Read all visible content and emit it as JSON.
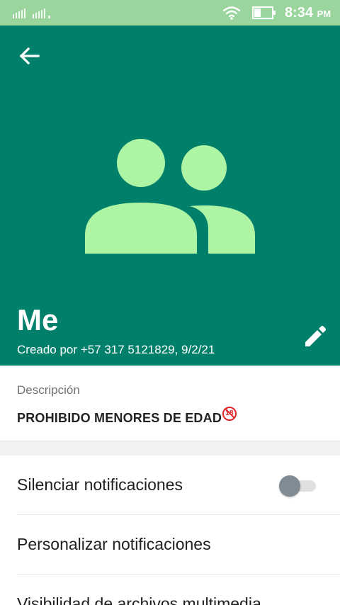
{
  "status_bar": {
    "time": "8:34",
    "ampm": "PM",
    "icons": [
      "signal-icon",
      "wifi-icon",
      "battery-icon"
    ]
  },
  "header": {
    "group_name": "Me",
    "created_text": "Creado por +57 317 5121829, 9/2/21",
    "background_color": "#00806a",
    "avatar_color": "#aef4a5"
  },
  "description": {
    "label": "Descripción",
    "text": "PROHIBIDO MENORES DE EDAD",
    "emoji": "18"
  },
  "settings": {
    "items": [
      {
        "label": "Silenciar notificaciones",
        "toggle": false
      },
      {
        "label": "Personalizar notificaciones"
      },
      {
        "label": "Visibilidad de archivos multimedia"
      }
    ]
  }
}
